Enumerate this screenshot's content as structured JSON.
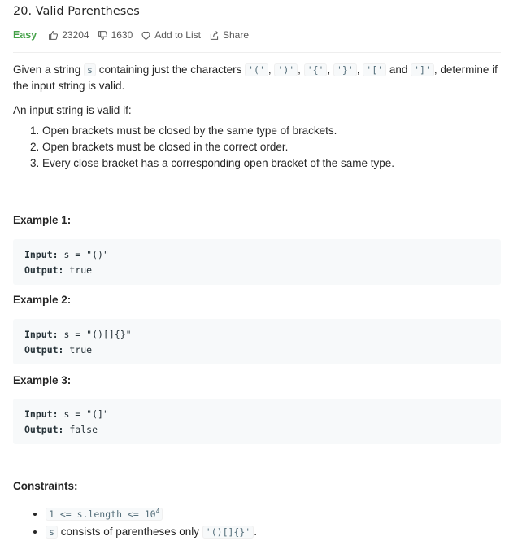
{
  "problem": {
    "title": "20. Valid Parentheses",
    "difficulty": "Easy",
    "likes": "23204",
    "dislikes": "1630",
    "add_to_list": "Add to List",
    "share": "Share"
  },
  "description": {
    "p1_a": "Given a string ",
    "p1_s": "s",
    "p1_b": " containing just the characters ",
    "c1": "'('",
    "sep1": ", ",
    "c2": "')'",
    "sep2": ", ",
    "c3": "'{'",
    "sep3": ", ",
    "c4": "'}'",
    "sep4": ", ",
    "c5": "'['",
    "and": " and ",
    "c6": "']'",
    "p1_c": ", determine if the input string is valid.",
    "valid_if": "An input string is valid if:",
    "rules": [
      "Open brackets must be closed by the same type of brackets.",
      "Open brackets must be closed in the correct order.",
      "Every close bracket has a corresponding open bracket of the same type."
    ]
  },
  "examples": [
    {
      "title": "Example 1:",
      "input_label": "Input:",
      "input": "s = \"()\"",
      "output_label": "Output:",
      "output": "true"
    },
    {
      "title": "Example 2:",
      "input_label": "Input:",
      "input": "s = \"()[]{}\"",
      "output_label": "Output:",
      "output": "true"
    },
    {
      "title": "Example 3:",
      "input_label": "Input:",
      "input": "s = \"(]\"",
      "output_label": "Output:",
      "output": "false"
    }
  ],
  "constraints": {
    "title": "Constraints:",
    "c1_code": "1 <= s.length <= 10",
    "c1_sup": "4",
    "c2_code_a": "s",
    "c2_text": " consists of parentheses only ",
    "c2_code_b": "'()[]{}'",
    "c2_end": "."
  },
  "colors": {
    "easy": "#43a047",
    "code_bg": "#f7f9fa"
  }
}
